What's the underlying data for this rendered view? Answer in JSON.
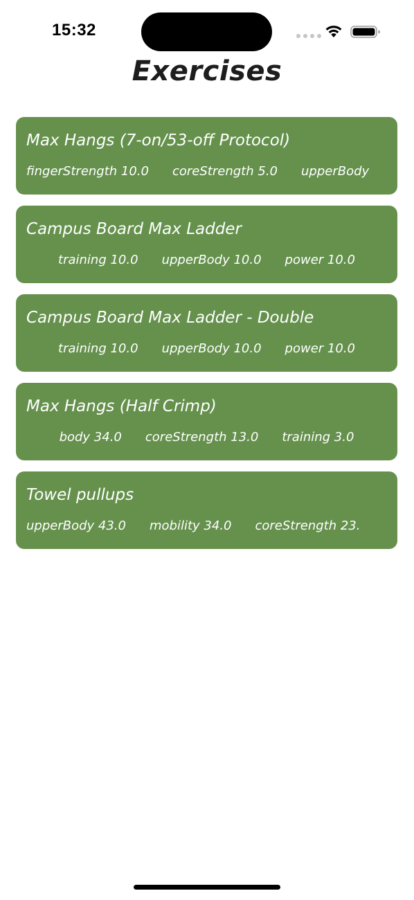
{
  "status_bar": {
    "time": "15:32"
  },
  "header": {
    "title": "Exercises"
  },
  "exercises": [
    {
      "name": "Max Hangs (7-on/53-off Protocol)",
      "stats": [
        "fingerStrength 10.0",
        "coreStrength 5.0",
        "upperBody"
      ]
    },
    {
      "name": "Campus Board Max Ladder",
      "stats": [
        "training 10.0",
        "upperBody 10.0",
        "power 10.0"
      ]
    },
    {
      "name": "Campus Board Max Ladder - Double",
      "stats": [
        "training 10.0",
        "upperBody 10.0",
        "power 10.0"
      ]
    },
    {
      "name": "Max Hangs (Half Crimp)",
      "stats": [
        "body 34.0",
        "coreStrength 13.0",
        "training 3.0"
      ]
    },
    {
      "name": "Towel pullups",
      "stats": [
        "upperBody 43.0",
        "mobility 34.0",
        "coreStrength 23."
      ]
    }
  ],
  "colors": {
    "card_background": "#65914d",
    "card_text": "#ffffff",
    "title_text": "#1d1d1d"
  },
  "icons": [
    "signal-icon",
    "wifi-icon",
    "battery-icon"
  ]
}
